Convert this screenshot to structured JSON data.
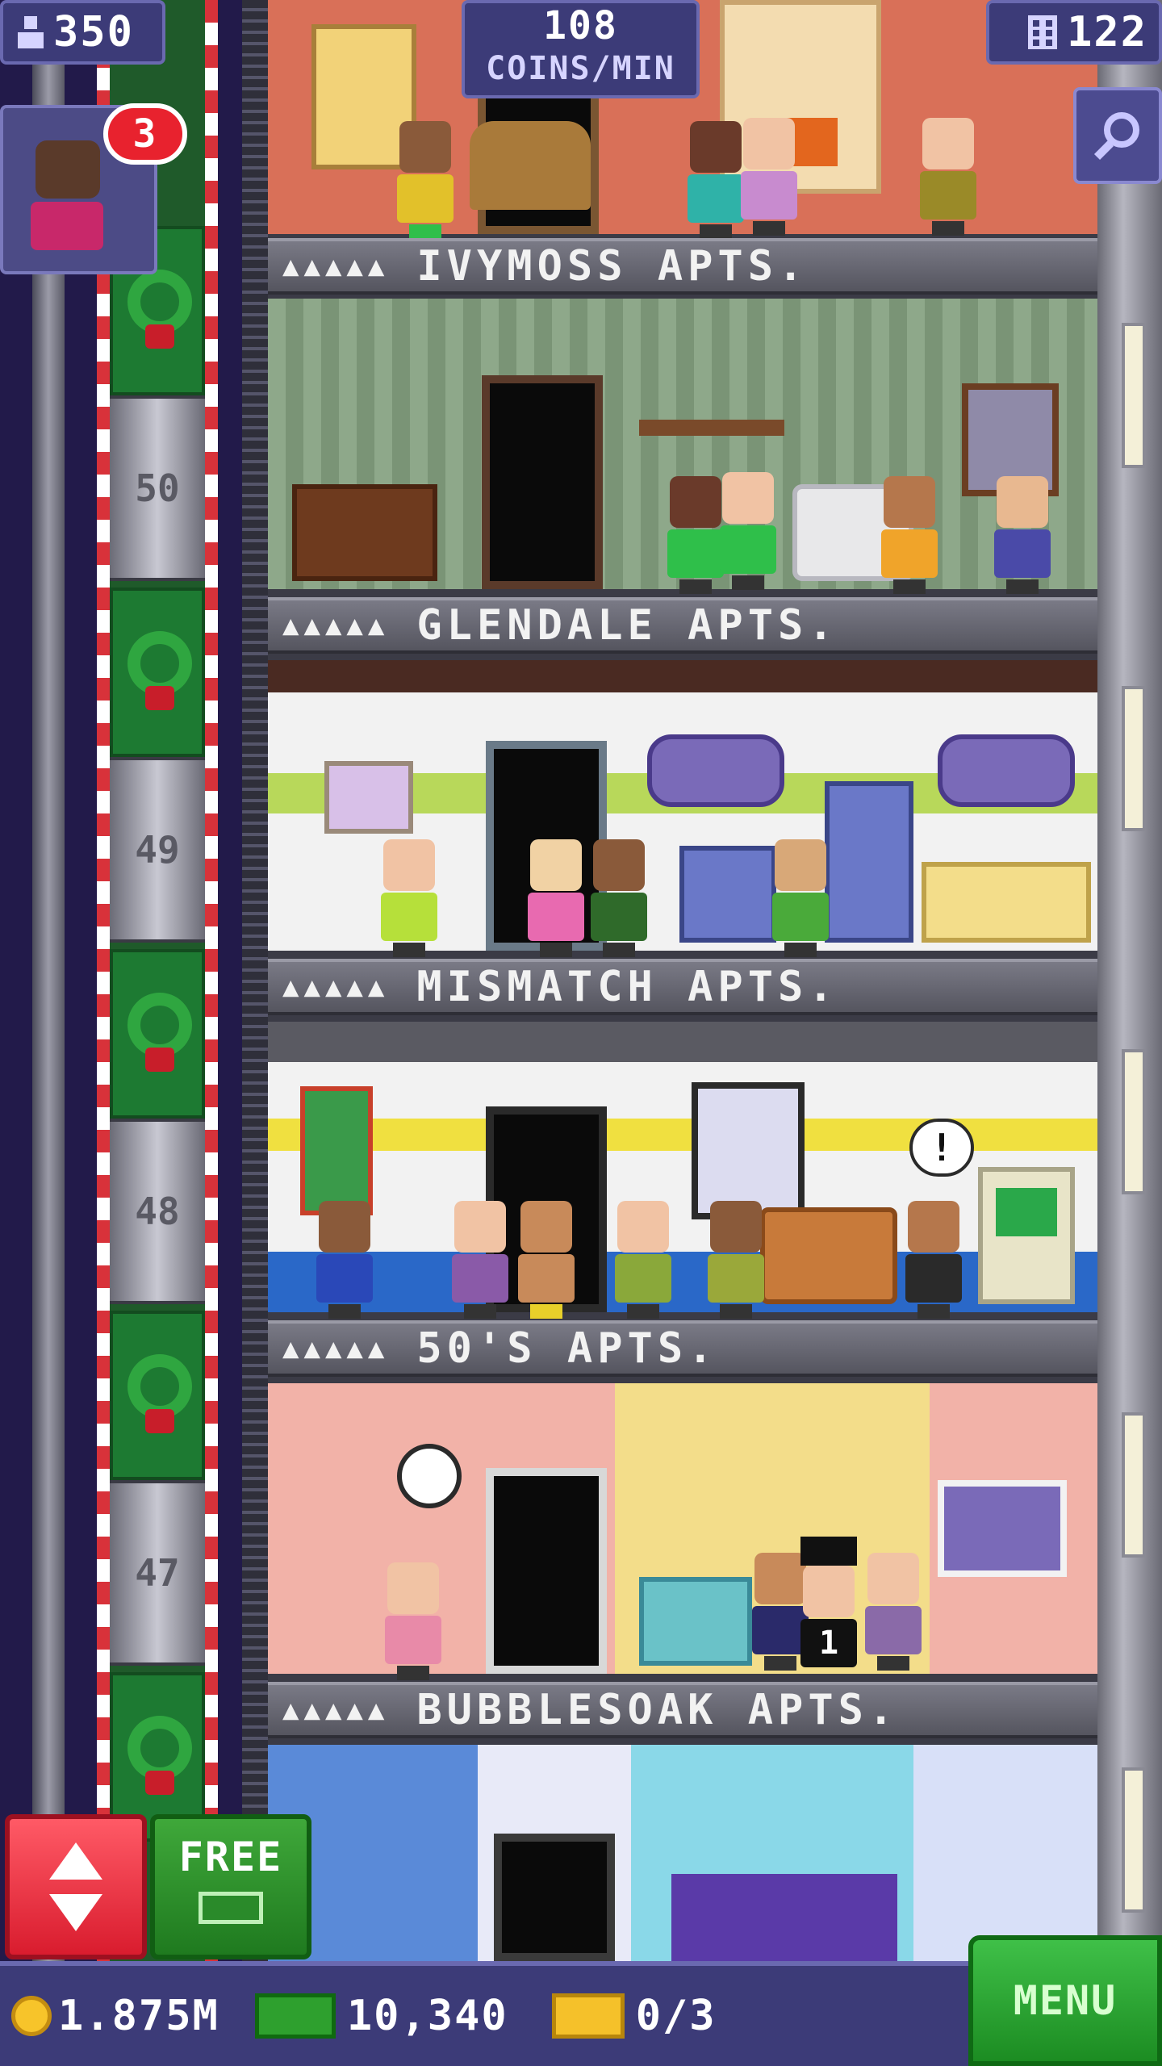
{
  "hud": {
    "population": "350",
    "coins_per_min_value": "108",
    "coins_per_min_unit": "COINS/MIN",
    "floor_count": "122",
    "visitor_badge": "3"
  },
  "floors": [
    {
      "name": "IVYMOSS APTS.",
      "stars": "▲▲▲▲▲"
    },
    {
      "name": "GLENDALE APTS.",
      "stars": "▲▲▲▲▲"
    },
    {
      "name": "MISMATCH APTS.",
      "stars": "▲▲▲▲▲"
    },
    {
      "name": "50'S APTS.",
      "stars": "▲▲▲▲▲"
    },
    {
      "name": "BUBBLESOAK APTS.",
      "stars": "▲▲▲▲▲"
    }
  ],
  "elevator": {
    "floor_numbers": [
      "50",
      "49",
      "48",
      "47"
    ],
    "passenger_marker": "1"
  },
  "buttons": {
    "free_label": "FREE",
    "menu_label": "MENU",
    "bubble": "!"
  },
  "bottom": {
    "coins": "1.875M",
    "bux": "10,340",
    "tickets": "0/3"
  },
  "icons": {
    "population": "person-icon",
    "floors": "building-icon",
    "search": "magnifier-icon",
    "coin": "coin-icon",
    "bux": "cash-icon",
    "ticket": "ticket-icon"
  },
  "colors": {
    "hud_bg": "#3c3b78",
    "menu_green": "#2aa632",
    "elevator_red": "#e8222e",
    "wreath_green": "#1d7a32"
  }
}
